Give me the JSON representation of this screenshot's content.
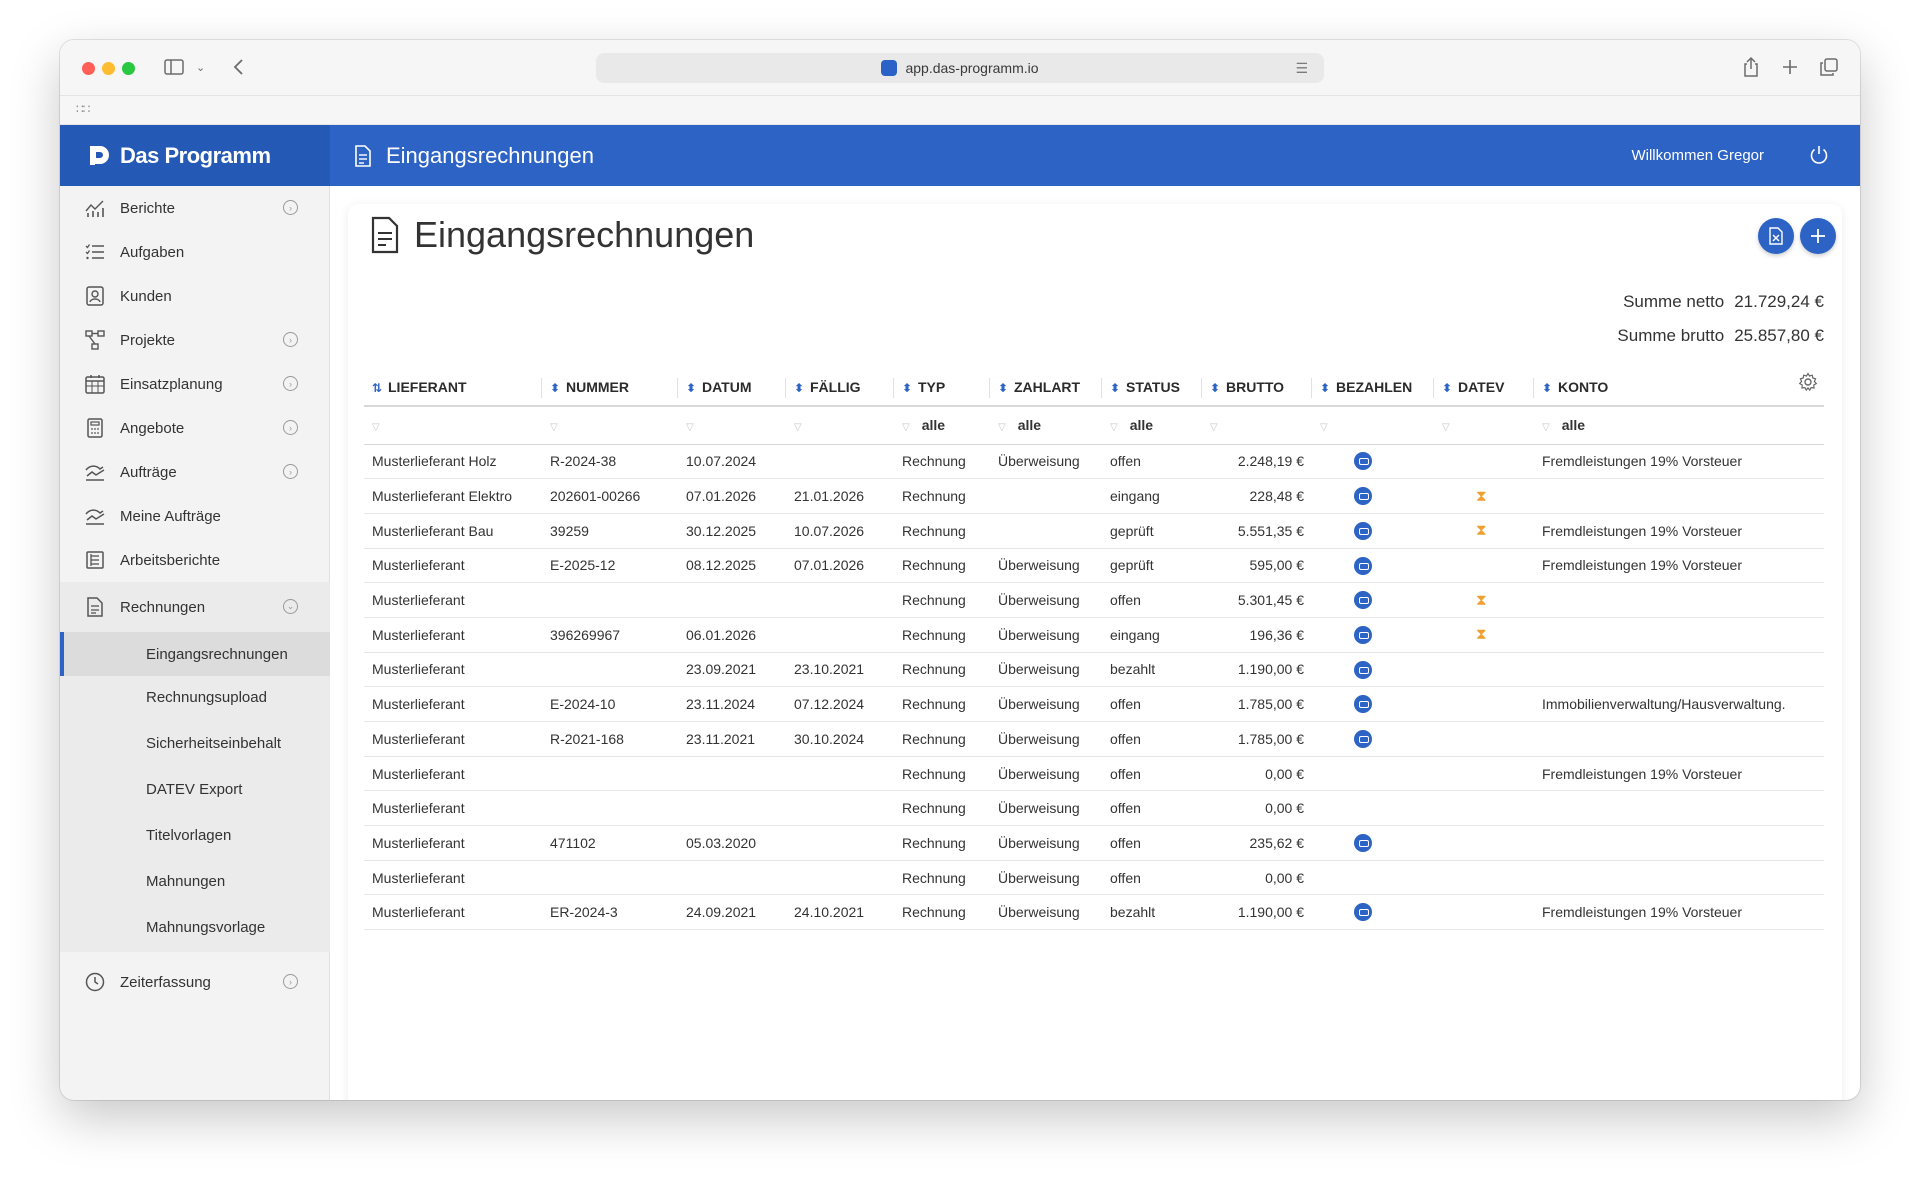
{
  "browser": {
    "url": "app.das-programm.io"
  },
  "app": {
    "brand": "Das Programm",
    "header_title": "Eingangsrechnungen",
    "welcome": "Willkommen Gregor"
  },
  "sidebar": {
    "items": [
      {
        "label": "Berichte",
        "icon": "chart-icon",
        "chevron": true
      },
      {
        "label": "Aufgaben",
        "icon": "task-list-icon",
        "chevron": false
      },
      {
        "label": "Kunden",
        "icon": "contacts-icon",
        "chevron": false
      },
      {
        "label": "Projekte",
        "icon": "project-tree-icon",
        "chevron": true
      },
      {
        "label": "Einsatzplanung",
        "icon": "calendar-icon",
        "chevron": true
      },
      {
        "label": "Angebote",
        "icon": "calculator-icon",
        "chevron": true
      },
      {
        "label": "Aufträge",
        "icon": "orders-icon",
        "chevron": true
      },
      {
        "label": "Meine Aufträge",
        "icon": "my-orders-icon",
        "chevron": false
      },
      {
        "label": "Arbeitsberichte",
        "icon": "report-icon",
        "chevron": false
      },
      {
        "label": "Rechnungen",
        "icon": "invoice-icon",
        "chevron": true
      }
    ],
    "subitems": [
      "Eingangsrechnungen",
      "Rechnungsupload",
      "Sicherheitseinbehalt",
      "DATEV Export",
      "Titelvorlagen",
      "Mahnungen",
      "Mahnungsvorlage"
    ],
    "last_item": "Zeiterfassung"
  },
  "main": {
    "title": "Eingangsrechnungen",
    "sum_netto_label": "Summe netto",
    "sum_netto_value": "21.729,24 €",
    "sum_brutto_label": "Summe brutto",
    "sum_brutto_value": "25.857,80 €",
    "columns": [
      "LIEFERANT",
      "NUMMER",
      "DATUM",
      "FÄLLIG",
      "TYP",
      "ZAHLART",
      "STATUS",
      "BRUTTO",
      "BEZAHLEN",
      "DATEV",
      "KONTO"
    ],
    "filters": {
      "typ": "alle",
      "zahlart": "alle",
      "status": "alle",
      "konto": "alle"
    },
    "rows": [
      {
        "lieferant": "Musterlieferant Holz",
        "nummer": "R-2024-38",
        "datum": "10.07.2024",
        "faellig": "",
        "typ": "Rechnung",
        "zahlart": "Überweisung",
        "status": "offen",
        "brutto": "2.248,19 €",
        "bezahlen": true,
        "datev": false,
        "konto": "Fremdleistungen 19% Vorsteuer"
      },
      {
        "lieferant": "Musterlieferant Elektro",
        "nummer": "202601-00266",
        "datum": "07.01.2026",
        "faellig": "21.01.2026",
        "typ": "Rechnung",
        "zahlart": "",
        "status": "eingang",
        "brutto": "228,48 €",
        "bezahlen": true,
        "datev": true,
        "konto": ""
      },
      {
        "lieferant": "Musterlieferant Bau",
        "nummer": "39259",
        "datum": "30.12.2025",
        "faellig": "10.07.2026",
        "typ": "Rechnung",
        "zahlart": "",
        "status": "geprüft",
        "brutto": "5.551,35 €",
        "bezahlen": true,
        "datev": true,
        "konto": "Fremdleistungen 19% Vorsteuer"
      },
      {
        "lieferant": "Musterlieferant",
        "nummer": "E-2025-12",
        "datum": "08.12.2025",
        "faellig": "07.01.2026",
        "typ": "Rechnung",
        "zahlart": "Überweisung",
        "status": "geprüft",
        "brutto": "595,00 €",
        "bezahlen": true,
        "datev": false,
        "konto": "Fremdleistungen 19% Vorsteuer"
      },
      {
        "lieferant": "Musterlieferant",
        "nummer": "",
        "datum": "",
        "faellig": "",
        "typ": "Rechnung",
        "zahlart": "Überweisung",
        "status": "offen",
        "brutto": "5.301,45 €",
        "bezahlen": true,
        "datev": true,
        "konto": ""
      },
      {
        "lieferant": "Musterlieferant",
        "nummer": "396269967",
        "datum": "06.01.2026",
        "faellig": "",
        "typ": "Rechnung",
        "zahlart": "Überweisung",
        "status": "eingang",
        "brutto": "196,36 €",
        "bezahlen": true,
        "datev": true,
        "konto": ""
      },
      {
        "lieferant": "Musterlieferant",
        "nummer": "",
        "datum": "23.09.2021",
        "faellig": "23.10.2021",
        "typ": "Rechnung",
        "zahlart": "Überweisung",
        "status": "bezahlt",
        "brutto": "1.190,00 €",
        "bezahlen": true,
        "datev": false,
        "konto": ""
      },
      {
        "lieferant": "Musterlieferant",
        "nummer": "E-2024-10",
        "datum": "23.11.2024",
        "faellig": "07.12.2024",
        "typ": "Rechnung",
        "zahlart": "Überweisung",
        "status": "offen",
        "brutto": "1.785,00 €",
        "bezahlen": true,
        "datev": false,
        "konto": "Immobilienverwaltung/Hausverwaltung."
      },
      {
        "lieferant": "Musterlieferant",
        "nummer": "R-2021-168",
        "datum": "23.11.2021",
        "faellig": "30.10.2024",
        "typ": "Rechnung",
        "zahlart": "Überweisung",
        "status": "offen",
        "brutto": "1.785,00 €",
        "bezahlen": true,
        "datev": false,
        "konto": ""
      },
      {
        "lieferant": "Musterlieferant",
        "nummer": "",
        "datum": "",
        "faellig": "",
        "typ": "Rechnung",
        "zahlart": "Überweisung",
        "status": "offen",
        "brutto": "0,00 €",
        "bezahlen": false,
        "datev": false,
        "konto": "Fremdleistungen 19% Vorsteuer"
      },
      {
        "lieferant": "Musterlieferant",
        "nummer": "",
        "datum": "",
        "faellig": "",
        "typ": "Rechnung",
        "zahlart": "Überweisung",
        "status": "offen",
        "brutto": "0,00 €",
        "bezahlen": false,
        "datev": false,
        "konto": ""
      },
      {
        "lieferant": "Musterlieferant",
        "nummer": "471102",
        "datum": "05.03.2020",
        "faellig": "",
        "typ": "Rechnung",
        "zahlart": "Überweisung",
        "status": "offen",
        "brutto": "235,62 €",
        "bezahlen": true,
        "datev": false,
        "konto": ""
      },
      {
        "lieferant": "Musterlieferant",
        "nummer": "",
        "datum": "",
        "faellig": "",
        "typ": "Rechnung",
        "zahlart": "Überweisung",
        "status": "offen",
        "brutto": "0,00 €",
        "bezahlen": false,
        "datev": false,
        "konto": ""
      },
      {
        "lieferant": "Musterlieferant",
        "nummer": "ER-2024-3",
        "datum": "24.09.2021",
        "faellig": "24.10.2021",
        "typ": "Rechnung",
        "zahlart": "Überweisung",
        "status": "bezahlt",
        "brutto": "1.190,00 €",
        "bezahlen": true,
        "datev": false,
        "konto": "Fremdleistungen 19% Vorsteuer"
      }
    ]
  },
  "colors": {
    "primary": "#2c63c4",
    "brand_bg": "#2459b5",
    "sidebar_bg": "#f3f3f3",
    "hourglass": "#f0a030"
  }
}
